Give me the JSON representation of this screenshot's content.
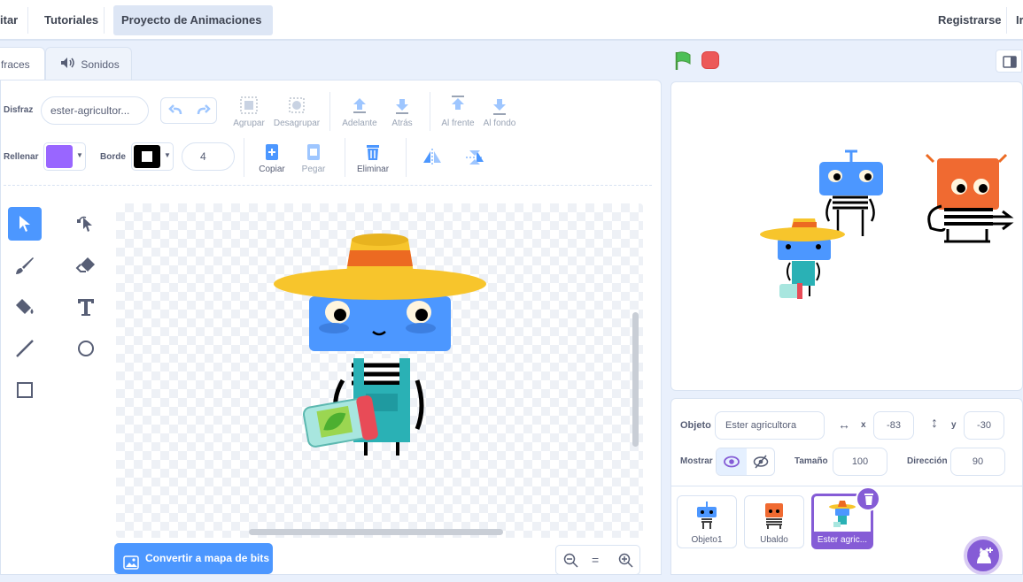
{
  "menu": {
    "item_edit": "itar",
    "item_tutorials": "Tutoriales",
    "project_title": "Proyecto de Animaciones",
    "register": "Registrarse",
    "signin": "Ir"
  },
  "tabs": {
    "costumes": "fraces",
    "sounds": "Sonidos"
  },
  "toolbar": {
    "costume_label": "Disfraz",
    "costume_name": "ester-agricultor...",
    "group": "Agrupar",
    "ungroup": "Desagrupar",
    "forward": "Adelante",
    "backward": "Atrás",
    "front": "Al frente",
    "back": "Al fondo",
    "fill_label": "Rellenar",
    "outline_label": "Borde",
    "outline_width": "4",
    "copy": "Copiar",
    "paste": "Pegar",
    "delete": "Eliminar"
  },
  "convert_button": "Convertir a mapa de bits",
  "sprite_info": {
    "object_label": "Objeto",
    "object_name": "Ester agricultora",
    "x_label": "x",
    "x_value": "-83",
    "y_label": "y",
    "y_value": "-30",
    "show_label": "Mostrar",
    "size_label": "Tamaño",
    "size_value": "100",
    "direction_label": "Dirección",
    "direction_value": "90"
  },
  "sprites": [
    {
      "name": "Objeto1"
    },
    {
      "name": "Ubaldo"
    },
    {
      "name": "Ester agric..."
    }
  ],
  "colors": {
    "accent": "#4c97ff",
    "fill": "#9966ff",
    "selected_sprite": "#855cd6",
    "green_flag": "#4cbf56",
    "stop": "#ec5959"
  }
}
